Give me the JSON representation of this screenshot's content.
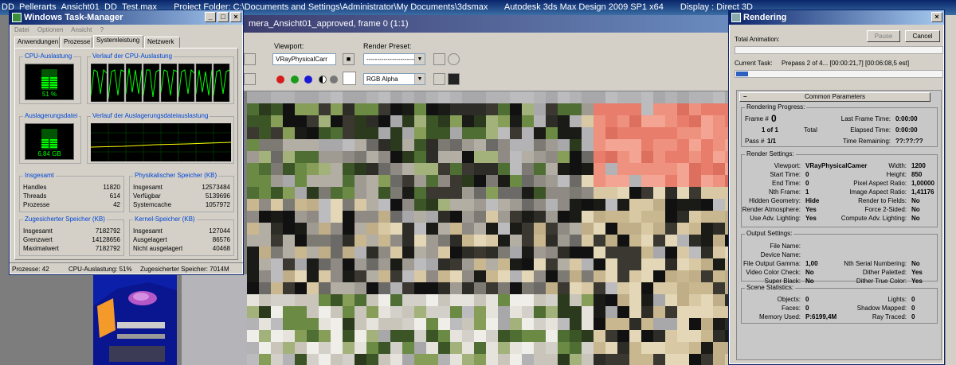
{
  "topbar": {
    "file_title": "DD_Pellerarts_Ansicht01_DD_Test.max",
    "project_folder": "Project Folder: C:\\Documents and Settings\\Administrator\\My Documents\\3dsmax",
    "app_name": "Autodesk 3ds Max Design 2009 SP1   x64",
    "display": "Display : Direct 3D"
  },
  "frame_window": {
    "title": "mera_Ansicht01_approved, frame 0 (1:1)"
  },
  "render_toolbar": {
    "viewport_label": "Viewport:",
    "viewport_value": "VRayPhysicalCarr",
    "preset_label": "Render Preset:",
    "preset_value": "--------------------------",
    "channel_value": "RGB Alpha"
  },
  "task_manager": {
    "title": "Windows Task-Manager",
    "menu": [
      "Datei",
      "Optionen",
      "Ansicht",
      "?"
    ],
    "tabs": [
      "Anwendungen",
      "Prozesse",
      "Systemleistung",
      "Netzwerk"
    ],
    "cpu_usage_label": "CPU-Auslastung",
    "cpu_usage_value": "51 %",
    "cpu_history_label": "Verlauf der CPU-Auslastung",
    "pagefile_label": "Auslagerungsdatei",
    "pagefile_value": "6,84 GB",
    "pagefile_history_label": "Verlauf der Auslagerungsdateiauslastung",
    "totals": {
      "title": "Insgesamt",
      "rows": [
        {
          "k": "Handles",
          "v": "11820"
        },
        {
          "k": "Threads",
          "v": "614"
        },
        {
          "k": "Prozesse",
          "v": "42"
        }
      ]
    },
    "physical": {
      "title": "Physikalischer Speicher (KB)",
      "rows": [
        {
          "k": "Insgesamt",
          "v": "12573484"
        },
        {
          "k": "Verfügbar",
          "v": "5139696"
        },
        {
          "k": "Systemcache",
          "v": "1057972"
        }
      ]
    },
    "commit": {
      "title": "Zugesicherter Speicher (KB)",
      "rows": [
        {
          "k": "Insgesamt",
          "v": "7182792"
        },
        {
          "k": "Grenzwert",
          "v": "14128656"
        },
        {
          "k": "Maximalwert",
          "v": "7182792"
        }
      ]
    },
    "kernel": {
      "title": "Kernel-Speicher (KB)",
      "rows": [
        {
          "k": "Insgesamt",
          "v": "127044"
        },
        {
          "k": "Ausgelagert",
          "v": "86576"
        },
        {
          "k": "Nicht ausgelagert",
          "v": "40468"
        }
      ]
    },
    "status": {
      "processes": "Prozesse: 42",
      "cpu": "CPU-Auslastung: 51%",
      "commit": "Zugesicherter Speicher: 7014M"
    }
  },
  "rendering": {
    "title": "Rendering",
    "total_animation_label": "Total Animation:",
    "pause_label": "Pause",
    "cancel_label": "Cancel",
    "current_task_label": "Current Task:",
    "current_task_value": "Prepass 2 of 4...  [00:00:21,7] [00:06:08,5 est]",
    "current_task_progress": 0.06,
    "common_params_label": "Common Parameters",
    "progress": {
      "title": "Rendering Progress:",
      "frame_label": "Frame #",
      "frame_value": "0",
      "of_value": "1 of 1",
      "total_label": "Total",
      "pass_label": "Pass #",
      "pass_value": "1/1",
      "last_frame_label": "Last Frame Time:",
      "last_frame_value": "0:00:00",
      "elapsed_label": "Elapsed Time:",
      "elapsed_value": "0:00:00",
      "remaining_label": "Time Remaining:",
      "remaining_value": "??:??:??"
    },
    "settings": {
      "title": "Render Settings:",
      "rows": [
        {
          "lk": "Viewport:",
          "lv": "VRayPhysicalCamer",
          "rk": "Width:",
          "rv": "1200"
        },
        {
          "lk": "Start Time:",
          "lv": "0",
          "rk": "Height:",
          "rv": "850"
        },
        {
          "lk": "End Time:",
          "lv": "0",
          "rk": "Pixel Aspect Ratio:",
          "rv": "1,00000"
        },
        {
          "lk": "Nth Frame:",
          "lv": "1",
          "rk": "Image Aspect Ratio:",
          "rv": "1,41176"
        },
        {
          "lk": "Hidden Geometry:",
          "lv": "Hide",
          "rk": "Render to Fields:",
          "rv": "No"
        },
        {
          "lk": "Render Atmosphere:",
          "lv": "Yes",
          "rk": "Force 2-Sided:",
          "rv": "No"
        },
        {
          "lk": "Use Adv. Lighting:",
          "lv": "Yes",
          "rk": "Compute Adv. Lighting:",
          "rv": "No"
        }
      ]
    },
    "output": {
      "title": "Output Settings:",
      "file_name_label": "File Name:",
      "device_name_label": "Device Name:",
      "rows": [
        {
          "lk": "File Output Gamma:",
          "lv": "1,00",
          "rk": "Nth Serial Numbering:",
          "rv": "No"
        },
        {
          "lk": "Video Color Check:",
          "lv": "No",
          "rk": "Dither Paletted:",
          "rv": "Yes"
        },
        {
          "lk": "Super Black:",
          "lv": "No",
          "rk": "Dither True Color:",
          "rv": "Yes"
        }
      ]
    },
    "scene": {
      "title": "Scene Statistics:",
      "rows": [
        {
          "lk": "Objects:",
          "lv": "0",
          "rk": "Lights:",
          "rv": "0"
        },
        {
          "lk": "Faces:",
          "lv": "0",
          "rk": "Shadow Mapped:",
          "rv": "0"
        },
        {
          "lk": "Memory Used:",
          "lv": "P:6199,4M",
          "rk": "Ray Traced:",
          "rv": "0"
        }
      ]
    }
  },
  "colors": {
    "accent": "#0a246a",
    "tm_green": "#00ff00",
    "pixel_red": "#e97d6b"
  }
}
